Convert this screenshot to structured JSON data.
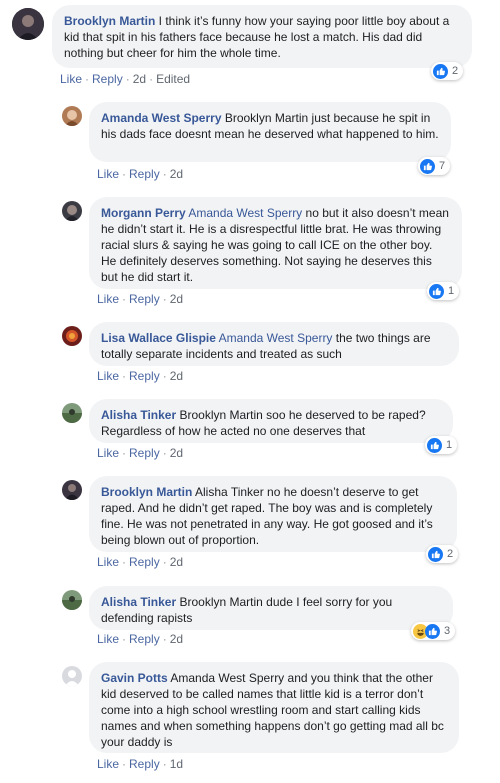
{
  "comments": [
    {
      "author": "Brooklyn Martin",
      "mention": "",
      "text": " I think it’s funny how your saying poor little boy about a kid that spit in his fathers face because he lost a match. His dad did nothing but cheer for him the whole time.",
      "like": "Like",
      "reply": "Reply",
      "time": "2d",
      "edited": "Edited",
      "reactions": "2"
    },
    {
      "author": "Amanda West Sperry",
      "mention": "",
      "text": " Brooklyn Martin just because he spit in his dads face doesnt mean he deserved what happened to him.",
      "like": "Like",
      "reply": "Reply",
      "time": "2d",
      "reactions": "7"
    },
    {
      "author": "Morgann Perry",
      "mention": " Amanda West Sperry",
      "text": " no but it also doesn’t mean he didn’t start it. He is a disrespectful little brat. He was throwing racial slurs & saying he was going to call ICE on the other boy. He definitely deserves something. Not saying he deserves this but he did start it.",
      "like": "Like",
      "reply": "Reply",
      "time": "2d",
      "reactions": "1"
    },
    {
      "author": "Lisa Wallace Glispie",
      "mention": " Amanda West Sperry",
      "text": " the two things are totally separate incidents and treated as such",
      "like": "Like",
      "reply": "Reply",
      "time": "2d",
      "reactions": ""
    },
    {
      "author": "Alisha Tinker",
      "mention": "",
      "text": " Brooklyn Martin soo he deserved to be raped? Regardless of how he acted no one deserves that",
      "like": "Like",
      "reply": "Reply",
      "time": "2d",
      "reactions": "1"
    },
    {
      "author": "Brooklyn Martin",
      "mention": "",
      "text": " Alisha Tinker no he doesn’t deserve to get raped. And he didn’t get raped. The boy was and is completely fine. He was not penetrated in any way. He got goosed and it’s being blown out of proportion.",
      "like": "Like",
      "reply": "Reply",
      "time": "2d",
      "reactions": "2"
    },
    {
      "author": "Alisha Tinker",
      "mention": "",
      "text": " Brooklyn Martin dude I feel sorry for you defending rapists",
      "like": "Like",
      "reply": "Reply",
      "time": "2d",
      "reactions": "3"
    },
    {
      "author": "Gavin Potts",
      "mention": "",
      "text": " Amanda West Sperry and you think that the other kid deserved to be called names that little kid is a terror don’t come into a high school wrestling room and start calling kids names and when something happens don’t go getting mad all bc your daddy is",
      "like": "Like",
      "reply": "Reply",
      "time": "1d",
      "reactions": ""
    }
  ],
  "colors": {
    "author": "#385898",
    "bubble": "#f2f3f5",
    "like_blue": "#1877f2",
    "meta": "#606770"
  }
}
